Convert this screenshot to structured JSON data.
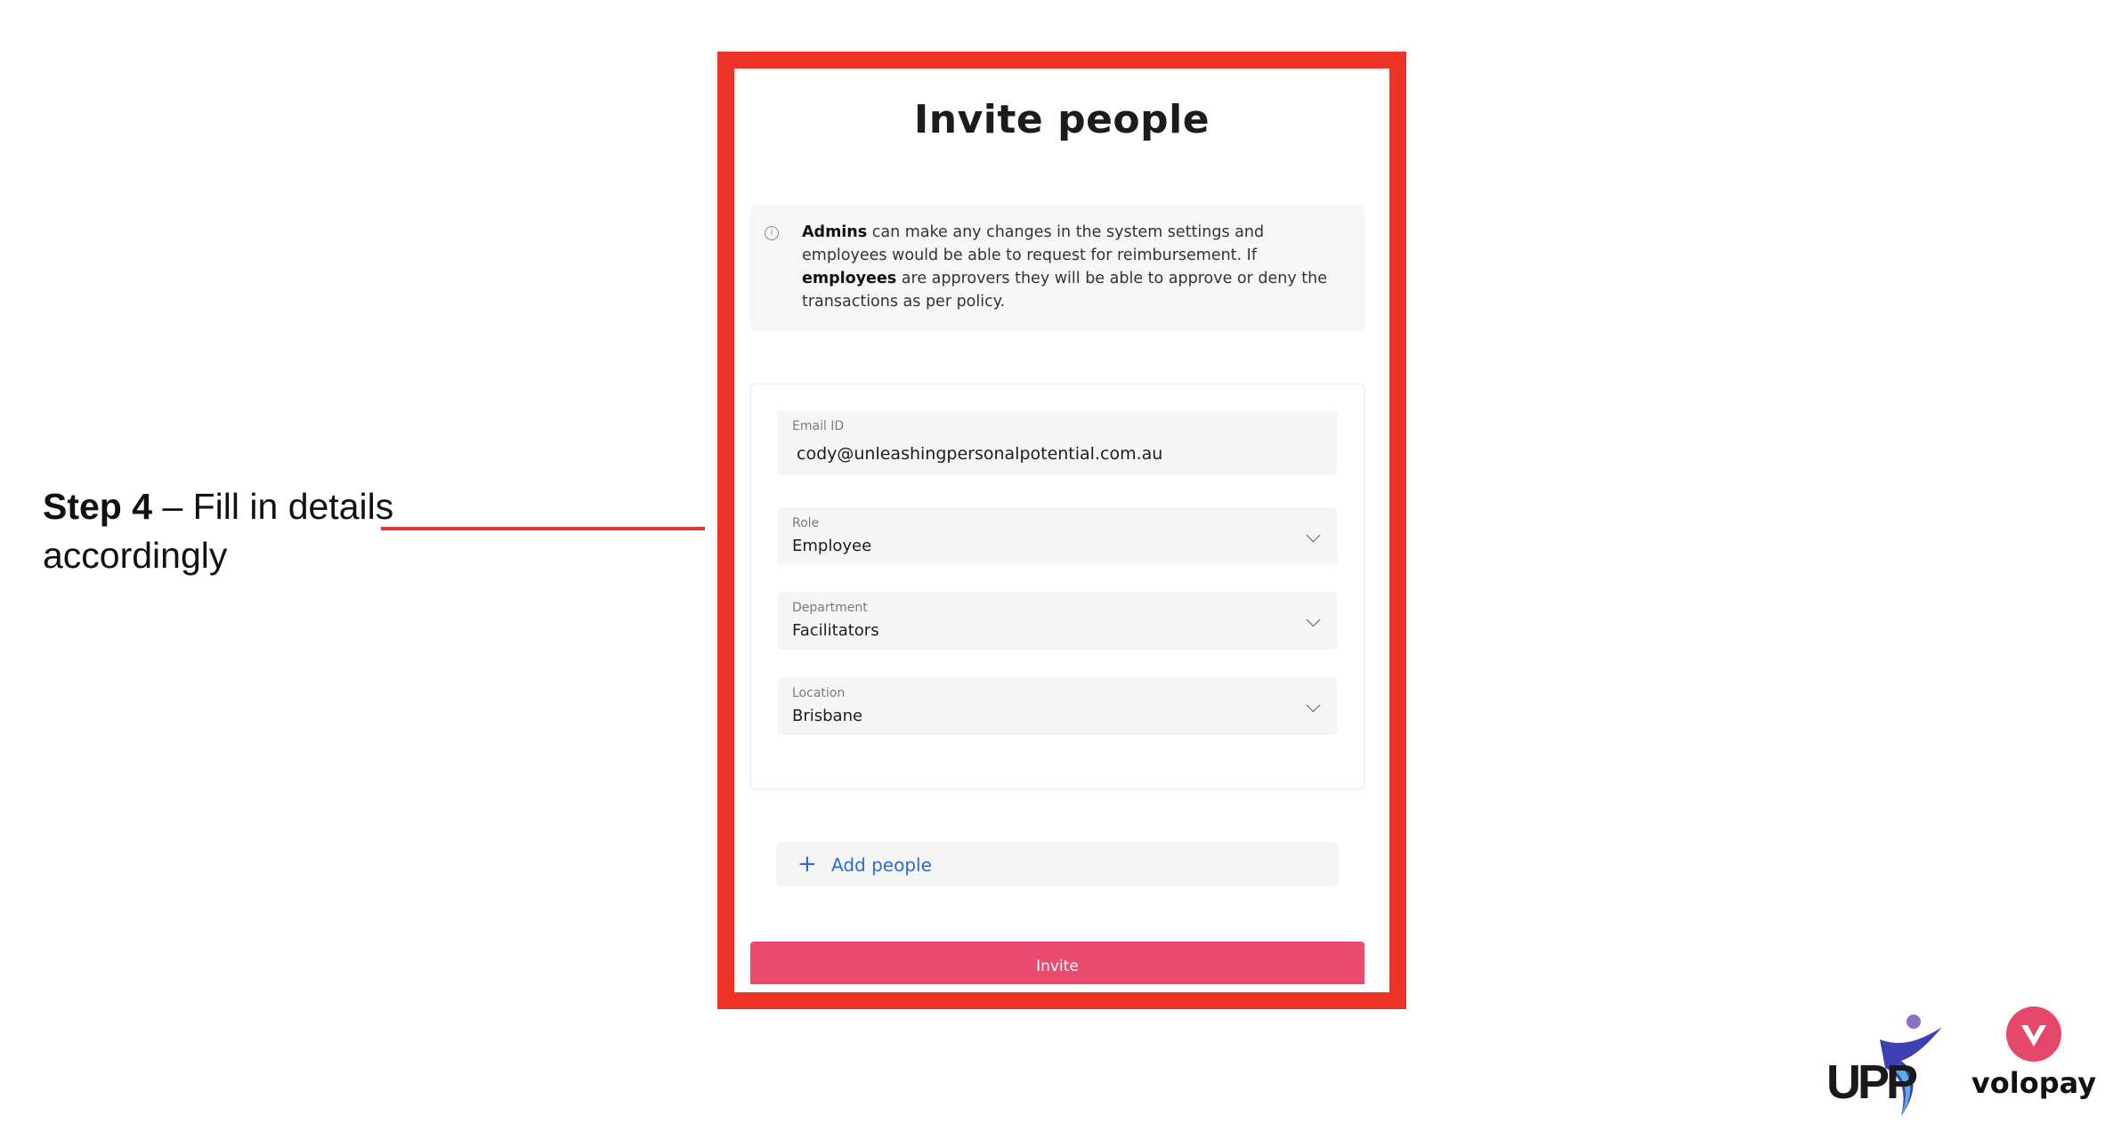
{
  "annotation": {
    "step_bold": "Step 4",
    "step_rest": " – Fill in details accordingly"
  },
  "modal": {
    "title": "Invite people",
    "info": {
      "icon": "info-icon",
      "bold_1": "Admins",
      "text_1": " can make any changes in the system settings and employees would be able to request for reimbursement. If ",
      "bold_2": "employees",
      "text_2": " are approvers they will be able to approve or deny the transactions as per policy."
    },
    "fields": {
      "email": {
        "label": "Email ID",
        "value": "cody@unleashingpersonalpotential.com.au"
      },
      "role": {
        "label": "Role",
        "value": "Employee"
      },
      "department": {
        "label": "Department",
        "value": "Facilitators"
      },
      "location": {
        "label": "Location",
        "value": "Brisbane"
      }
    },
    "add_people_label": "Add people",
    "invite_label": "Invite"
  },
  "logos": {
    "upp_text": "UPP",
    "volopay_text": "volopay"
  },
  "colors": {
    "frame": "#ed3325",
    "accent_blue": "#2a6ad9",
    "invite_button": "#ea4a6d",
    "volopay_brand": "#e6466a"
  }
}
